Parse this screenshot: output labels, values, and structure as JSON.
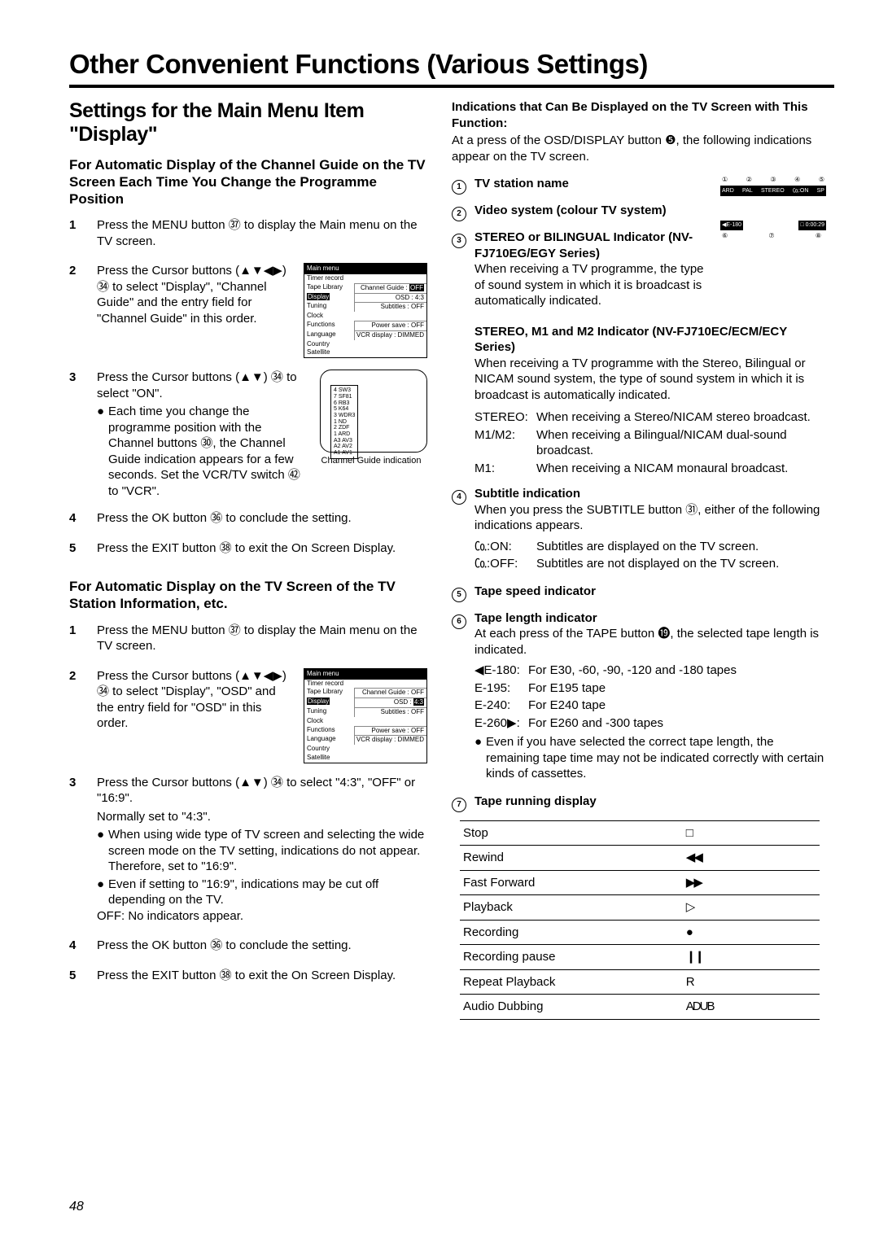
{
  "pageNumber": "48",
  "title": "Other Convenient Functions (Various Settings)",
  "sectionTitle": "Settings for the Main Menu Item \"Display\"",
  "partA": {
    "heading": "For Automatic Display of the Channel Guide on the TV Screen Each Time You Change the Programme Position",
    "step1": "Press the MENU button ㊲ to display the Main menu on the TV screen.",
    "step2": "Press the Cursor buttons (▲▼◀▶) ㉞ to select \"Display\", \"Channel Guide\" and the entry field for \"Channel Guide\" in this order.",
    "step3a": "Press the Cursor buttons (▲▼) ㉞ to select \"ON\".",
    "step3b": "Each time you change the programme position with the Channel buttons ㉚, the Channel Guide indication appears for a few seconds. Set the VCR/TV switch ㊷ to \"VCR\".",
    "cgCaption": "Channel Guide indication",
    "step4": "Press the OK button ㊱ to conclude the setting.",
    "step5": "Press the EXIT button ㊳ to exit the On Screen Display."
  },
  "menuFig1": {
    "title": "Main menu",
    "rows": [
      {
        "l": "Timer record",
        "r": ""
      },
      {
        "l": "Tape Library",
        "r": "Channel Guide : OFF",
        "hl": "OFF"
      },
      {
        "l": "Display",
        "r": "OSD : 4:3",
        "hlLeft": true
      },
      {
        "l": "Tuning",
        "r": "Subtitles : OFF"
      },
      {
        "l": "Clock",
        "r": ""
      },
      {
        "l": "Functions",
        "r": "Power save : OFF"
      },
      {
        "l": "Language",
        "r": "VCR display : DIMMED"
      },
      {
        "l": "Country",
        "r": ""
      },
      {
        "l": "Satellite",
        "r": ""
      }
    ]
  },
  "cgLines": [
    "4 SW3",
    "7 SF81",
    "6 RB3",
    "5 K64",
    "3 WDR3",
    "1 ND",
    "2 ZDF",
    "1 ARD",
    "A3 AV3",
    "A2 AV2",
    "A1 AV1"
  ],
  "partB": {
    "heading": "For Automatic Display on the TV Screen of the TV Station Information, etc.",
    "step1": "Press the MENU button ㊲ to display the Main menu on the TV screen.",
    "step2": "Press the Cursor buttons (▲▼◀▶) ㉞ to select \"Display\", \"OSD\" and the entry field for \"OSD\" in this order.",
    "step3a": "Press the Cursor buttons (▲▼) ㉞ to select \"4:3\", \"OFF\" or \"16:9\".",
    "step3n": "Normally set to \"4:3\".",
    "step3b1": "When using wide type of TV screen and selecting the wide screen mode on the TV setting, indications do not appear.",
    "step3b1b": "Therefore, set to \"16:9\".",
    "step3b2": "Even if setting to \"16:9\", indications may be cut off depending on the TV.",
    "step3off": "OFF:  No indicators appear.",
    "step4": "Press the OK button ㊱ to conclude the setting.",
    "step5": "Press the EXIT button ㊳ to exit the On Screen Display."
  },
  "menuFig2": {
    "title": "Main menu",
    "rows": [
      {
        "l": "Timer record",
        "r": ""
      },
      {
        "l": "Tape Library",
        "r": "Channel Guide : OFF"
      },
      {
        "l": "Display",
        "r": "OSD : 4:3",
        "hlLeft": true,
        "hl": "4:3"
      },
      {
        "l": "Tuning",
        "r": "Subtitles : OFF"
      },
      {
        "l": "Clock",
        "r": ""
      },
      {
        "l": "Functions",
        "r": "Power save : OFF"
      },
      {
        "l": "Language",
        "r": "VCR display : DIMMED"
      },
      {
        "l": "Country",
        "r": ""
      },
      {
        "l": "Satellite",
        "r": ""
      }
    ]
  },
  "right": {
    "head": "Indications that Can Be Displayed on the TV Screen with This Function:",
    "intro": "At a press of the OSD/DISPLAY button ❺, the following indications appear on the TV screen.",
    "i1": "TV station name",
    "i2": "Video system (colour TV system)",
    "i3h": "STEREO or BILINGUAL Indicator (NV-FJ710EG/EGY Series)",
    "i3t": "When receiving a TV programme, the type of sound system in which it is broadcast is automatically indicated.",
    "i3h2": "STEREO, M1 and M2 Indicator (NV-FJ710EC/ECM/ECY Series)",
    "i3t2": "When receiving a TV programme with the Stereo, Bilingual or NICAM sound system, the type of sound system in which it is broadcast is automatically indicated.",
    "sound": [
      {
        "k": "STEREO:",
        "v": "When receiving a Stereo/NICAM stereo broadcast."
      },
      {
        "k": "M1/M2:",
        "v": "When receiving a Bilingual/NICAM dual-sound broadcast."
      },
      {
        "k": "M1:",
        "v": "When receiving a NICAM monaural broadcast."
      }
    ],
    "i4h": "Subtitle indication",
    "i4t": "When you press the SUBTITLE button ㉛, either of the following indications appears.",
    "sub": [
      {
        "k": "㏇:ON:",
        "v": "Subtitles are displayed on the TV screen."
      },
      {
        "k": "㏇:OFF:",
        "v": "Subtitles are not displayed on the TV screen."
      }
    ],
    "i5": "Tape speed indicator",
    "i6h": "Tape length indicator",
    "i6t": "At each press of the TAPE button ⓳, the selected tape length is indicated.",
    "tape": [
      {
        "k": "◀E-180:",
        "v": "For E30, -60, -90, -120 and -180 tapes"
      },
      {
        "k": "E-195:",
        "v": "For E195 tape"
      },
      {
        "k": "E-240:",
        "v": "For E240 tape"
      },
      {
        "k": "E-260▶:",
        "v": "For E260 and -300 tapes"
      }
    ],
    "i6b": "Even if you have selected the correct tape length, the remaining tape time may not be indicated correctly with certain kinds of cassettes.",
    "i7": "Tape running display",
    "runTable": [
      {
        "k": "Stop",
        "v": "□"
      },
      {
        "k": "Rewind",
        "v": "◀◀"
      },
      {
        "k": "Fast Forward",
        "v": "▶▶"
      },
      {
        "k": "Playback",
        "v": "▷"
      },
      {
        "k": "Recording",
        "v": "●"
      },
      {
        "k": "Recording pause",
        "v": "❙❙"
      },
      {
        "k": "Repeat Playback",
        "v": "R"
      },
      {
        "k": "Audio Dubbing",
        "v": "ADUB"
      }
    ]
  },
  "tvIcons": {
    "top": [
      "①",
      "②",
      "③",
      "④",
      "⑤"
    ],
    "black1": [
      "ARD",
      "PAL",
      "STEREO",
      "㏇:ON",
      "SP"
    ],
    "black2": [
      "◀E-180",
      "□ 0:00:29"
    ],
    "bot": [
      "⑥",
      "⑦",
      "⑧"
    ]
  }
}
